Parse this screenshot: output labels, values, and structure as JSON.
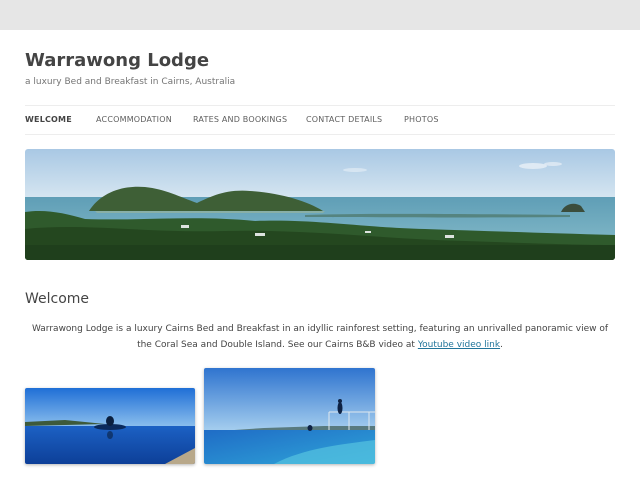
{
  "site": {
    "title": "Warrawong Lodge",
    "description": "a luxury Bed and Breakfast in Cairns, Australia"
  },
  "nav": {
    "items": [
      {
        "label": "WELCOME",
        "active": true
      },
      {
        "label": "ACCOMMODATION",
        "active": false
      },
      {
        "label": "RATES AND BOOKINGS",
        "active": false
      },
      {
        "label": "CONTACT DETAILS",
        "active": false
      },
      {
        "label": "PHOTOS",
        "active": false
      }
    ]
  },
  "main": {
    "heading": "Welcome",
    "intro_text": "Warrawong Lodge is a luxury Cairns Bed and Breakfast in an idyllic rainforest setting, featuring an unrivalled panoramic view of the Coral Sea and Double Island. See our Cairns B&B video at",
    "video_link_text": "Youtube video link",
    "intro_end": "."
  },
  "colors": {
    "outer_background": "#e6e6e6",
    "page_background": "#ffffff",
    "link": "#21759b",
    "text": "#444444"
  }
}
